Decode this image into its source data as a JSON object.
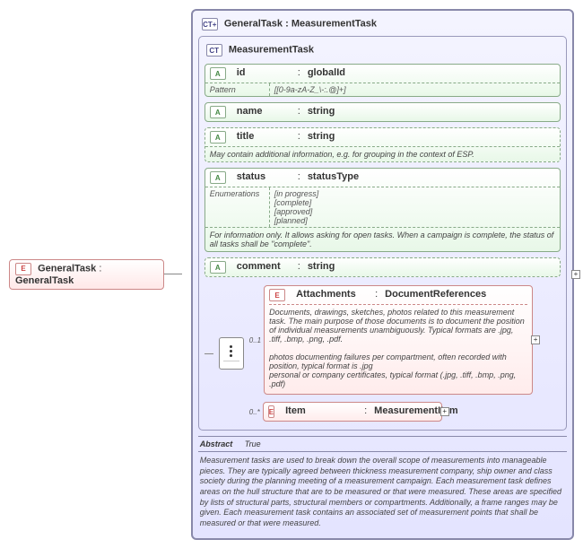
{
  "root": {
    "name": "GeneralTask",
    "type": "GeneralTask"
  },
  "main": {
    "headerName": "GeneralTask",
    "headerType": "MeasurementTask",
    "innerCtName": "MeasurementTask",
    "attrs": {
      "id": {
        "name": "id",
        "type": "globalId",
        "patternLbl": "Pattern",
        "pattern": "[[0-9a-zA-Z_\\-:.@]+]"
      },
      "name": {
        "name": "name",
        "type": "string"
      },
      "title": {
        "name": "title",
        "type": "string",
        "desc": "May contain additional information, e.g. for grouping in the context of ESP."
      },
      "status": {
        "name": "status",
        "type": "statusType",
        "enumLbl": "Enumerations",
        "enumVals": "[in progress]\n[complete]\n[approved]\n[planned]",
        "desc": "For information only. It allows asking for open tasks. When a campaign is complete, the status of all tasks shall be \"complete\"."
      },
      "comment": {
        "name": "comment",
        "type": "string"
      }
    },
    "sequence": {
      "attachments": {
        "card": "0..1",
        "name": "Attachments",
        "type": "DocumentReferences",
        "desc": "Documents, drawings, sketches, photos related to this measurement task. The main purpose of those documents is to document the position of individual measurements unambiguously. Typical formats are .jpg, .tiff, .bmp, .png, .pdf.\n\n    photos documenting failures per compartment, often recorded with position, typical format is .jpg\n    personal or company certificates, typical format (.jpg, .tiff, .bmp, .png, .pdf)"
      },
      "item": {
        "card": "0..*",
        "name": "Item",
        "type": "MeasurementItem"
      }
    },
    "abstract": {
      "lbl": "Abstract",
      "val": "True"
    },
    "longDesc": "Measurement tasks are used to break down the overall scope of measurements into manageable pieces. They are typically agreed between thickness measurement company, ship owner and class society during the planning meeting of a measurement campaign. Each measurement task defines areas on the hull structure that are to be measured or that were measured. These areas are specified by lists of structural parts, structural members or compartments. Additionally, a frame ranges may be given. Each measurement task contains an associated set of measurement points that shall be measured or that were measured."
  }
}
